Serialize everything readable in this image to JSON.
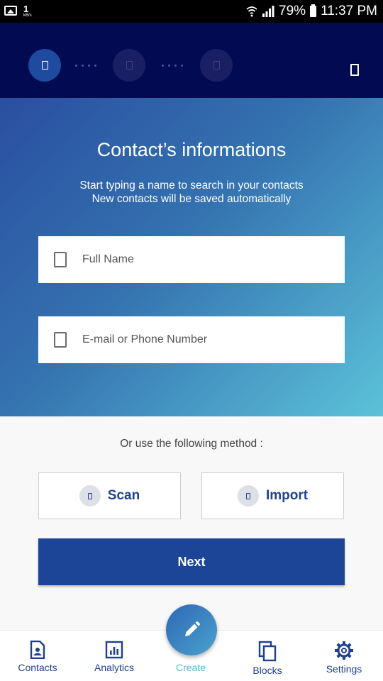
{
  "status_bar": {
    "speed_value": "1",
    "speed_unit": "kB/s",
    "battery": "79%",
    "time": "11:37 PM"
  },
  "stepper": {
    "steps": [
      "step-1",
      "step-2",
      "step-3"
    ],
    "active_step": 1
  },
  "hero": {
    "title": "Contact’s informations",
    "subtitle_line1": "Start typing a name to search in your contacts",
    "subtitle_line2": "New contacts will be saved automatically"
  },
  "form": {
    "full_name_placeholder": "Full Name",
    "contact_placeholder": "E-mail or Phone Number"
  },
  "methods": {
    "label": "Or use the following method :",
    "scan_label": "Scan",
    "import_label": "Import"
  },
  "next_label": "Next",
  "bottom_nav": {
    "contacts": "Contacts",
    "analytics": "Analytics",
    "create": "Create",
    "blocks": "Blocks",
    "settings": "Settings"
  },
  "colors": {
    "header_bg": "#020a52",
    "primary": "#1c4598",
    "create_accent": "#58b6d6"
  }
}
